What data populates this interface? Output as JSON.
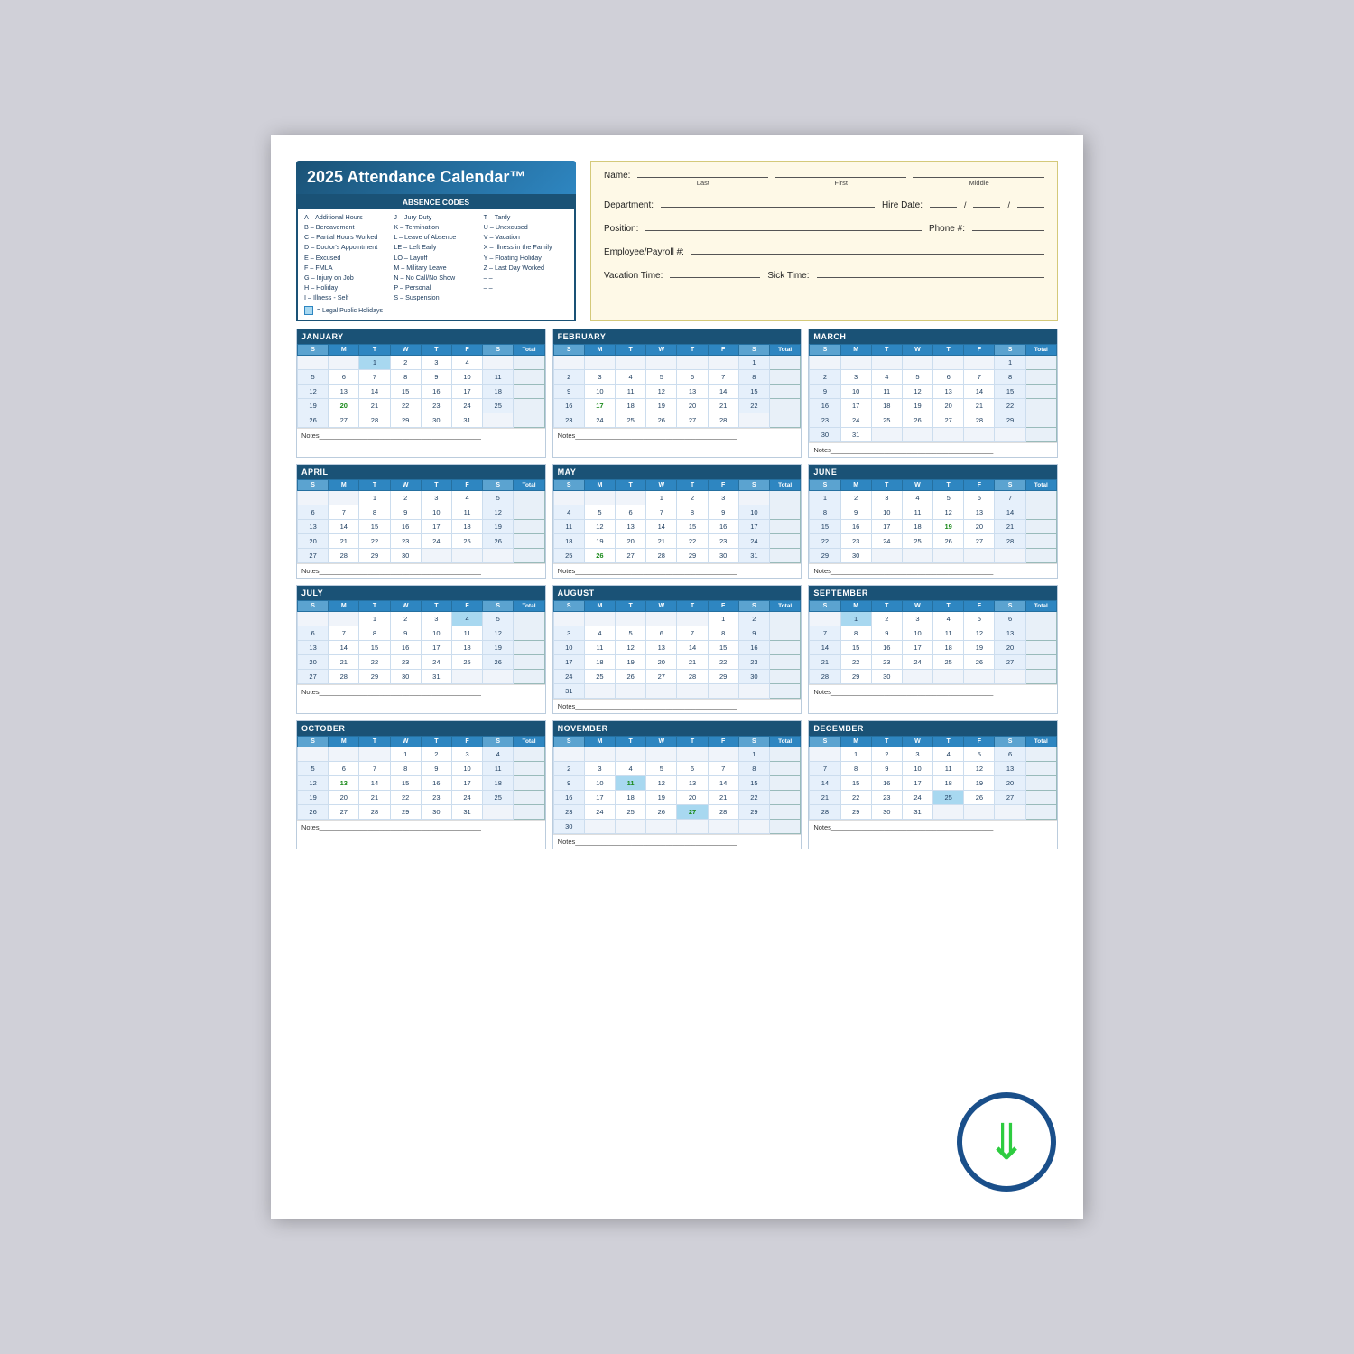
{
  "title": "2025 Attendance Calendar™",
  "absence_codes": {
    "title": "ABSENCE CODES",
    "col1": [
      "A – Additional Hours",
      "B – Bereavement",
      "C – Partial Hours Worked",
      "D – Doctor's Appointment",
      "E – Excused",
      "F – FMLA",
      "G – Injury on Job",
      "H – Holiday",
      "I  – Illness - Self"
    ],
    "col2": [
      "J  – Jury Duty",
      "K – Termination",
      "L  – Leave of Absence",
      "LE – Left Early",
      "LO – Layoff",
      "M – Military Leave",
      "N – No Call/No Show",
      "P  – Personal",
      "S  – Suspension"
    ],
    "col3": [
      "T – Tardy",
      "U – Unexcused",
      "V – Vacation",
      "X – Illness in the Family",
      "Y – Floating Holiday",
      "Z – Last Day Worked",
      "– –",
      "– –",
      ""
    ],
    "holiday_note": "= Legal Public Holidays"
  },
  "form": {
    "name_label": "Name:",
    "last_label": "Last",
    "first_label": "First",
    "middle_label": "Middle",
    "dept_label": "Department:",
    "hire_label": "Hire Date:",
    "position_label": "Position:",
    "phone_label": "Phone #:",
    "emp_label": "Employee/Payroll #:",
    "vac_label": "Vacation Time:",
    "sick_label": "Sick Time:"
  },
  "months": [
    {
      "name": "JANUARY",
      "days": [
        [
          "",
          "",
          "1",
          "2",
          "3",
          "4",
          ""
        ],
        [
          "5",
          "6",
          "7",
          "8",
          "9",
          "10",
          "11"
        ],
        [
          "12",
          "13",
          "14",
          "15",
          "16",
          "17",
          "18"
        ],
        [
          "19",
          "20",
          "21",
          "22",
          "23",
          "24",
          "25"
        ],
        [
          "26",
          "27",
          "28",
          "29",
          "30",
          "31",
          ""
        ]
      ],
      "holidays": [
        "1"
      ],
      "green_days": [
        "20"
      ]
    },
    {
      "name": "FEBRUARY",
      "days": [
        [
          "",
          "",
          "",
          "",
          "",
          "",
          "1"
        ],
        [
          "2",
          "3",
          "4",
          "5",
          "6",
          "7",
          "8"
        ],
        [
          "9",
          "10",
          "11",
          "12",
          "13",
          "14",
          "15"
        ],
        [
          "16",
          "17",
          "18",
          "19",
          "20",
          "21",
          "22"
        ],
        [
          "23",
          "24",
          "25",
          "26",
          "27",
          "28",
          ""
        ]
      ],
      "holidays": [],
      "green_days": [
        "17"
      ]
    },
    {
      "name": "MARCH",
      "days": [
        [
          "",
          "",
          "",
          "",
          "",
          "",
          "1"
        ],
        [
          "2",
          "3",
          "4",
          "5",
          "6",
          "7",
          "8"
        ],
        [
          "9",
          "10",
          "11",
          "12",
          "13",
          "14",
          "15"
        ],
        [
          "16",
          "17",
          "18",
          "19",
          "20",
          "21",
          "22"
        ],
        [
          "23",
          "24",
          "25",
          "26",
          "27",
          "28",
          "29"
        ],
        [
          "30",
          "31",
          "",
          "",
          "",
          "",
          ""
        ]
      ],
      "holidays": [],
      "green_days": []
    },
    {
      "name": "APRIL",
      "days": [
        [
          "",
          "",
          "1",
          "2",
          "3",
          "4",
          "5"
        ],
        [
          "6",
          "7",
          "8",
          "9",
          "10",
          "11",
          "12"
        ],
        [
          "13",
          "14",
          "15",
          "16",
          "17",
          "18",
          "19"
        ],
        [
          "20",
          "21",
          "22",
          "23",
          "24",
          "25",
          "26"
        ],
        [
          "27",
          "28",
          "29",
          "30",
          "",
          "",
          ""
        ]
      ],
      "holidays": [],
      "green_days": []
    },
    {
      "name": "MAY",
      "days": [
        [
          "",
          "",
          "",
          "1",
          "2",
          "3",
          ""
        ],
        [
          "4",
          "5",
          "6",
          "7",
          "8",
          "9",
          "10"
        ],
        [
          "11",
          "12",
          "13",
          "14",
          "15",
          "16",
          "17"
        ],
        [
          "18",
          "19",
          "20",
          "21",
          "22",
          "23",
          "24"
        ],
        [
          "25",
          "26",
          "27",
          "28",
          "29",
          "30",
          "31"
        ]
      ],
      "holidays": [],
      "green_days": [
        "26"
      ]
    },
    {
      "name": "JUNE",
      "days": [
        [
          "1",
          "2",
          "3",
          "4",
          "5",
          "6",
          "7"
        ],
        [
          "8",
          "9",
          "10",
          "11",
          "12",
          "13",
          "14"
        ],
        [
          "15",
          "16",
          "17",
          "18",
          "19",
          "20",
          "21"
        ],
        [
          "22",
          "23",
          "24",
          "25",
          "26",
          "27",
          "28"
        ],
        [
          "29",
          "30",
          "",
          "",
          "",
          "",
          ""
        ]
      ],
      "holidays": [],
      "green_days": [
        "19"
      ]
    },
    {
      "name": "JULY",
      "days": [
        [
          "",
          "",
          "1",
          "2",
          "3",
          "4",
          "5"
        ],
        [
          "6",
          "7",
          "8",
          "9",
          "10",
          "11",
          "12"
        ],
        [
          "13",
          "14",
          "15",
          "16",
          "17",
          "18",
          "19"
        ],
        [
          "20",
          "21",
          "22",
          "23",
          "24",
          "25",
          "26"
        ],
        [
          "27",
          "28",
          "29",
          "30",
          "31",
          "",
          ""
        ]
      ],
      "holidays": [
        "4"
      ],
      "green_days": []
    },
    {
      "name": "AUGUST",
      "days": [
        [
          "",
          "",
          "",
          "",
          "",
          "1",
          "2"
        ],
        [
          "3",
          "4",
          "5",
          "6",
          "7",
          "8",
          "9"
        ],
        [
          "10",
          "11",
          "12",
          "13",
          "14",
          "15",
          "16"
        ],
        [
          "17",
          "18",
          "19",
          "20",
          "21",
          "22",
          "23"
        ],
        [
          "24",
          "25",
          "26",
          "27",
          "28",
          "29",
          "30"
        ],
        [
          "31",
          "",
          "",
          "",
          "",
          "",
          ""
        ]
      ],
      "holidays": [],
      "green_days": []
    },
    {
      "name": "SEPTEMBER",
      "days": [
        [
          "",
          "1",
          "2",
          "3",
          "4",
          "5",
          "6"
        ],
        [
          "7",
          "8",
          "9",
          "10",
          "11",
          "12",
          "13"
        ],
        [
          "14",
          "15",
          "16",
          "17",
          "18",
          "19",
          "20"
        ],
        [
          "21",
          "22",
          "23",
          "24",
          "25",
          "26",
          "27"
        ],
        [
          "28",
          "29",
          "30",
          "",
          "",
          "",
          ""
        ]
      ],
      "holidays": [
        "1"
      ],
      "green_days": []
    },
    {
      "name": "OCTOBER",
      "days": [
        [
          "",
          "",
          "",
          "1",
          "2",
          "3",
          "4"
        ],
        [
          "5",
          "6",
          "7",
          "8",
          "9",
          "10",
          "11"
        ],
        [
          "12",
          "13",
          "14",
          "15",
          "16",
          "17",
          "18"
        ],
        [
          "19",
          "20",
          "21",
          "22",
          "23",
          "24",
          "25"
        ],
        [
          "26",
          "27",
          "28",
          "29",
          "30",
          "31",
          ""
        ]
      ],
      "holidays": [],
      "green_days": [
        "13"
      ]
    },
    {
      "name": "NOVEMBER",
      "days": [
        [
          "",
          "",
          "",
          "",
          "",
          "",
          "1"
        ],
        [
          "2",
          "3",
          "4",
          "5",
          "6",
          "7",
          "8"
        ],
        [
          "9",
          "10",
          "11",
          "12",
          "13",
          "14",
          "15"
        ],
        [
          "16",
          "17",
          "18",
          "19",
          "20",
          "21",
          "22"
        ],
        [
          "23",
          "24",
          "25",
          "26",
          "27",
          "28",
          "29"
        ],
        [
          "30",
          "",
          "",
          "",
          "",
          "",
          ""
        ]
      ],
      "holidays": [
        "11",
        "27"
      ],
      "green_days": [
        "11",
        "27"
      ]
    },
    {
      "name": "DECEMBER",
      "days": [
        [
          "",
          "1",
          "2",
          "3",
          "4",
          "5",
          "6"
        ],
        [
          "7",
          "8",
          "9",
          "10",
          "11",
          "12",
          "13"
        ],
        [
          "14",
          "15",
          "16",
          "17",
          "18",
          "19",
          "20"
        ],
        [
          "21",
          "22",
          "23",
          "24",
          "25",
          "26",
          "27"
        ],
        [
          "28",
          "29",
          "30",
          "31",
          "",
          "",
          ""
        ]
      ],
      "holidays": [
        "25"
      ],
      "green_days": []
    }
  ],
  "day_headers": [
    "S",
    "M",
    "T",
    "W",
    "T",
    "F",
    "S",
    "Total"
  ],
  "notes_label": "Notes",
  "download_visible": true
}
